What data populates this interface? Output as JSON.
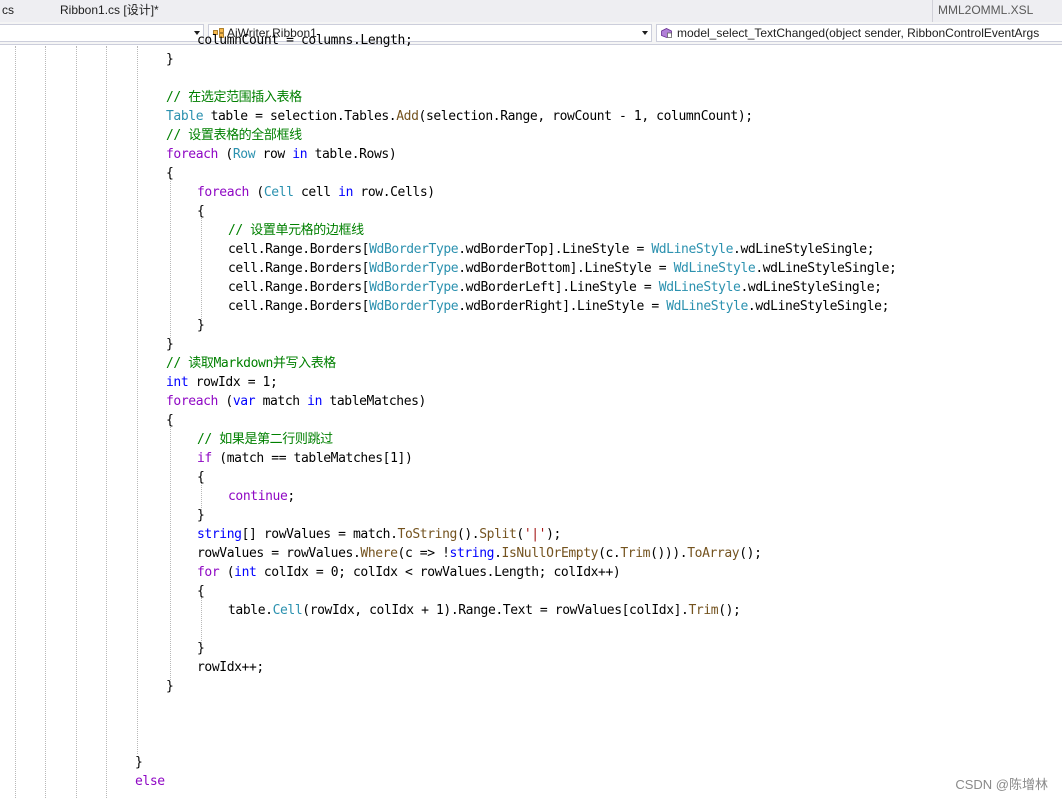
{
  "tabs": {
    "left_partial": "cs",
    "active": "Ribbon1.cs [设计]*",
    "right": "MML2OMML.XSL"
  },
  "nav": {
    "project_value": "",
    "class_value": "AiWriter.Ribbon1",
    "member_value": "model_select_TextChanged(object sender, RibbonControlEventArgs"
  },
  "code_lines": [
    {
      "indent": 2,
      "text": "columnCount = columns.Length;"
    },
    {
      "indent": 1,
      "text": "}"
    },
    {
      "indent": 1,
      "text": ""
    },
    {
      "indent": 1,
      "text": "// 在选定范围插入表格"
    },
    {
      "indent": 1,
      "text": "Table table = selection.Tables.Add(selection.Range, rowCount - 1, columnCount);"
    },
    {
      "indent": 1,
      "text": "// 设置表格的全部框线"
    },
    {
      "indent": 1,
      "text": "foreach (Row row in table.Rows)"
    },
    {
      "indent": 1,
      "text": "{"
    },
    {
      "indent": 2,
      "text": "foreach (Cell cell in row.Cells)"
    },
    {
      "indent": 2,
      "text": "{"
    },
    {
      "indent": 3,
      "text": "// 设置单元格的边框线"
    },
    {
      "indent": 3,
      "text": "cell.Range.Borders[WdBorderType.wdBorderTop].LineStyle = WdLineStyle.wdLineStyleSingle;"
    },
    {
      "indent": 3,
      "text": "cell.Range.Borders[WdBorderType.wdBorderBottom].LineStyle = WdLineStyle.wdLineStyleSingle;"
    },
    {
      "indent": 3,
      "text": "cell.Range.Borders[WdBorderType.wdBorderLeft].LineStyle = WdLineStyle.wdLineStyleSingle;"
    },
    {
      "indent": 3,
      "text": "cell.Range.Borders[WdBorderType.wdBorderRight].LineStyle = WdLineStyle.wdLineStyleSingle;"
    },
    {
      "indent": 2,
      "text": "}"
    },
    {
      "indent": 1,
      "text": "}"
    },
    {
      "indent": 1,
      "text": "// 读取Markdown并写入表格"
    },
    {
      "indent": 1,
      "text": "int rowIdx = 1;"
    },
    {
      "indent": 1,
      "text": "foreach (var match in tableMatches)"
    },
    {
      "indent": 1,
      "text": "{"
    },
    {
      "indent": 2,
      "text": "// 如果是第二行则跳过"
    },
    {
      "indent": 2,
      "text": "if (match == tableMatches[1])"
    },
    {
      "indent": 2,
      "text": "{"
    },
    {
      "indent": 3,
      "text": "continue;"
    },
    {
      "indent": 2,
      "text": "}"
    },
    {
      "indent": 2,
      "text": "string[] rowValues = match.ToString().Split('|');"
    },
    {
      "indent": 2,
      "text": "rowValues = rowValues.Where(c => !string.IsNullOrEmpty(c.Trim())).ToArray();"
    },
    {
      "indent": 2,
      "text": "for (int colIdx = 0; colIdx < rowValues.Length; colIdx++)"
    },
    {
      "indent": 2,
      "text": "{"
    },
    {
      "indent": 3,
      "text": "table.Cell(rowIdx, colIdx + 1).Range.Text = rowValues[colIdx].Trim();"
    },
    {
      "indent": 3,
      "text": ""
    },
    {
      "indent": 2,
      "text": "}"
    },
    {
      "indent": 2,
      "text": "rowIdx++;"
    },
    {
      "indent": 1,
      "text": "}"
    },
    {
      "indent": 1,
      "text": ""
    },
    {
      "indent": 1,
      "text": ""
    },
    {
      "indent": 1,
      "text": ""
    },
    {
      "indent": 0,
      "text": "}"
    },
    {
      "indent": 0,
      "text": "else"
    }
  ],
  "watermark": "CSDN @陈增林",
  "colors": {
    "keyword": "#0000ff",
    "type": "#2b91af",
    "comment": "#008000",
    "control": "#8f08c4",
    "method": "#74531f",
    "string": "#a31515"
  }
}
